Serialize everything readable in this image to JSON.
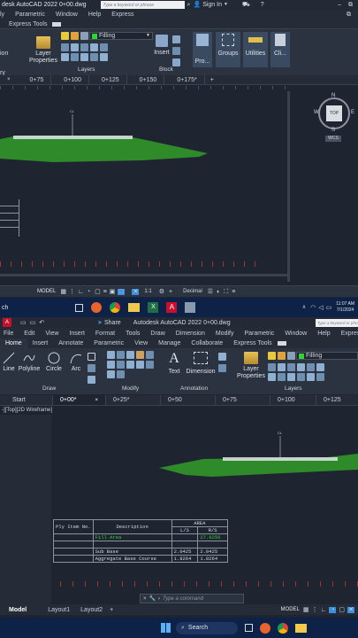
{
  "top": {
    "titlebar": {
      "title": "desk AutoCAD 2022   0+00.dwg",
      "search_placeholder": "Type a keyword or phrase",
      "sign_in": "Sign In"
    },
    "menu": [
      "ly",
      "Parametric",
      "Window",
      "Help",
      "Express"
    ],
    "ribbon_tab": "Express Tools",
    "layer_dropdown": "Filling",
    "panels": {
      "layer_properties": "Layer Properties",
      "layers": "Layers",
      "insert": "Insert",
      "block": "Block",
      "properties": "Pro...",
      "groups": "Groups",
      "utilities": "Utilities",
      "clipboard": "Cli..."
    },
    "left_labels": [
      "ion",
      "ry"
    ],
    "file_tabs": [
      "0+75",
      "0+100",
      "0+125",
      "0+150",
      "0+175*"
    ],
    "viewcube": {
      "face": "TOP",
      "n": "N",
      "s": "S",
      "e": "E",
      "w": "W",
      "wcs": "WCS"
    },
    "cl_label": "CL",
    "status": {
      "model": "MODEL",
      "scale": "1:1",
      "units": "Decimal"
    }
  },
  "taskbar_mid": {
    "search": "ch",
    "time": "11:07 AM",
    "date": "7/1/2024"
  },
  "bottom": {
    "titlebar": {
      "title": "Autodesk AutoCAD 2022   0+00.dwg",
      "search_placeholder": "Type a keyword or phrase",
      "share": "Share"
    },
    "menu": [
      "File",
      "Edit",
      "View",
      "Insert",
      "Format",
      "Tools",
      "Draw",
      "Dimension",
      "Modify",
      "Parametric",
      "Window",
      "Help",
      "Express"
    ],
    "ribbon_tabs": [
      "Home",
      "Insert",
      "Annotate",
      "Parametric",
      "View",
      "Manage",
      "Collaborate",
      "Express Tools"
    ],
    "draw_tools": [
      "Line",
      "Polyline",
      "Circle",
      "Arc"
    ],
    "panels": {
      "draw": "Draw",
      "modify": "Modify",
      "text": "Text",
      "dimension": "Dimension",
      "annotation": "Annotation",
      "layer_properties": "Layer Properties",
      "layers": "Layers"
    },
    "layer_dropdown": "Filling",
    "file_tabs": [
      "Start",
      "0+00*",
      "0+25*",
      "0+50",
      "0+75",
      "0+100",
      "0+125"
    ],
    "viewport_label": "-][Top][2D Wireframe]",
    "cl_label": "CL",
    "table": {
      "headers": [
        "Ply Item No.",
        "Description",
        "AREA",
        "L/S",
        "R/S"
      ],
      "rows": [
        [
          "",
          "Fill Area",
          "",
          "27.6256"
        ],
        [
          "",
          "",
          "",
          ""
        ],
        [
          "",
          "Sub Base",
          "2.0425",
          "2.0425"
        ],
        [
          "",
          "Aggregate Base Course",
          "1.8264",
          "1.8264"
        ]
      ]
    },
    "layout_tabs": [
      "Model",
      "Layout1",
      "Layout2"
    ],
    "command_placeholder": "Type a command",
    "status": {
      "model": "MODEL"
    }
  },
  "taskbar_bottom": {
    "search": "Search"
  },
  "colors": {
    "accent": "#3b8fe0",
    "terrain": "#2f8a2a",
    "red_ticks": "#c0392b",
    "bg_dark": "#1e2531"
  }
}
